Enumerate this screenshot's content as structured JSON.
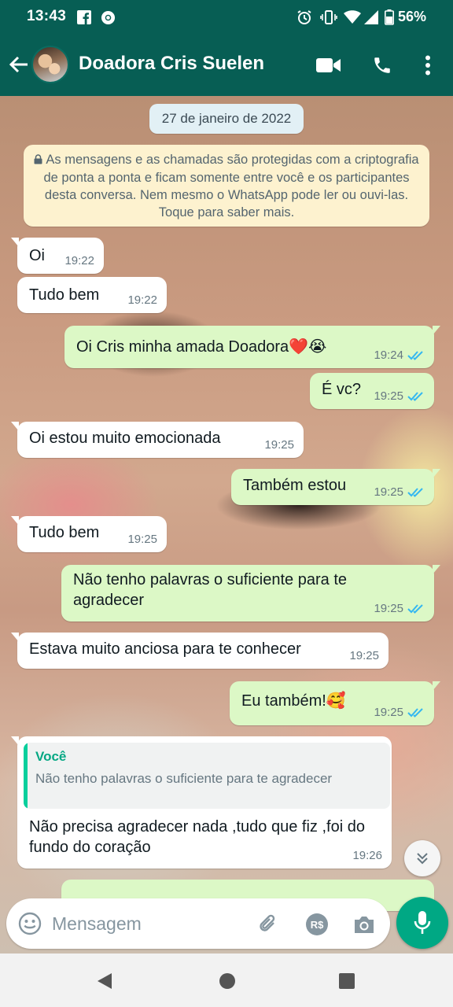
{
  "status_bar": {
    "time": "13:43",
    "battery_percent": "56%",
    "icons": [
      "facebook-icon",
      "chrome-icon",
      "alarm-icon",
      "vibrate-icon",
      "wifi-icon",
      "signal-icon",
      "battery-icon"
    ]
  },
  "header": {
    "contact_name": "Doadora Cris Suelen",
    "actions": [
      "video-call-icon",
      "voice-call-icon",
      "more-options-icon"
    ]
  },
  "chat": {
    "date": "27 de janeiro de 2022",
    "encryption_notice": "As mensagens e as chamadas são protegidas com a criptografia de ponta a ponta e ficam somente entre você e os participantes desta conversa. Nem mesmo o WhatsApp pode ler ou ouvi-las. Toque para saber mais.",
    "messages": [
      {
        "direction": "in",
        "text": "Oi",
        "time": "19:22"
      },
      {
        "direction": "in",
        "text": "Tudo bem",
        "time": "19:22"
      },
      {
        "direction": "out",
        "text": "Oi Cris minha amada Doadora❤️😭",
        "time": "19:24",
        "status": "read"
      },
      {
        "direction": "out",
        "text": "É vc?",
        "time": "19:25",
        "status": "read"
      },
      {
        "direction": "in",
        "text": "Oi estou muito emocionada",
        "time": "19:25"
      },
      {
        "direction": "out",
        "text": "Também estou",
        "time": "19:25",
        "status": "read"
      },
      {
        "direction": "in",
        "text": "Tudo bem",
        "time": "19:25"
      },
      {
        "direction": "out",
        "text": "Não tenho palavras o suficiente para te agradecer",
        "time": "19:25",
        "status": "read"
      },
      {
        "direction": "in",
        "text": "Estava muito anciosa para te conhecer",
        "time": "19:25"
      },
      {
        "direction": "out",
        "text": "Eu também!🥰",
        "time": "19:25",
        "status": "read"
      },
      {
        "direction": "in",
        "quote_author": "Você",
        "quote_text": "Não tenho palavras o suficiente para te agradecer",
        "text": "Não precisa agradecer nada ,tudo que fiz ,foi do fundo do coração",
        "time": "19:26"
      }
    ]
  },
  "composer": {
    "placeholder": "Mensagem"
  },
  "colors": {
    "header": "#075e54",
    "outgoing_bubble": "#dcf8c6",
    "incoming_bubble": "#ffffff",
    "read_ticks": "#34b7f1",
    "mic_button": "#00a884"
  }
}
